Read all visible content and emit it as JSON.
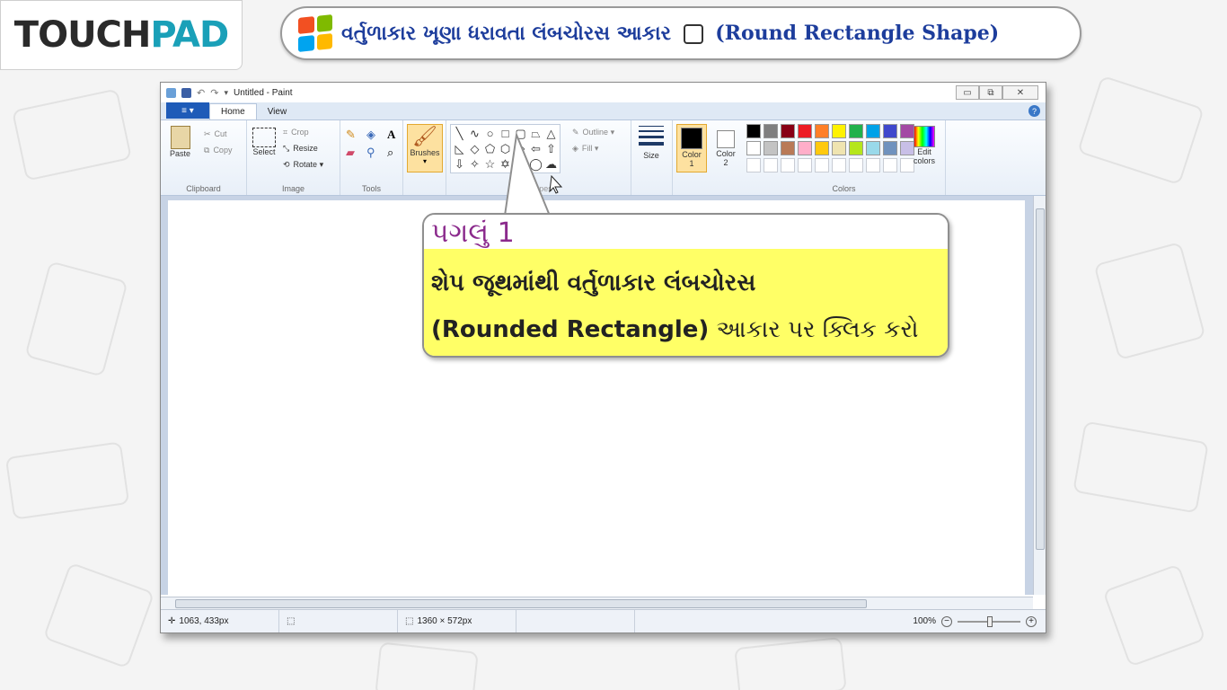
{
  "logo": {
    "part1": "TOUCH",
    "part2": "PAD"
  },
  "title": {
    "gujarati": "વર્તુળાકાર ખૂણા ધરાવતા લંબચોરસ આકાર",
    "english": "(Round Rectangle Shape)"
  },
  "window": {
    "title": "Untitled - Paint",
    "controls": {
      "minimize": "▭",
      "maximize": "⧉",
      "close": "✕"
    }
  },
  "tabs": {
    "file": "≡ ▾",
    "home": "Home",
    "view": "View",
    "help": "?"
  },
  "ribbon": {
    "clipboard": {
      "label": "Clipboard",
      "paste": "Paste",
      "cut": "Cut",
      "copy": "Copy"
    },
    "image": {
      "label": "Image",
      "select": "Select",
      "crop": "Crop",
      "resize": "Resize",
      "rotate": "Rotate ▾"
    },
    "tools": {
      "label": "Tools"
    },
    "brushes": {
      "label": "Brushes"
    },
    "shapes": {
      "label": "Shapes",
      "outline": "Outline ▾",
      "fill": "Fill ▾"
    },
    "size": {
      "label": "Size"
    },
    "color1": {
      "label": "Color",
      "num": "1"
    },
    "color2": {
      "label": "Color",
      "num": "2"
    },
    "colors": {
      "label": "Colors",
      "edit_label": "Edit",
      "edit_label2": "colors",
      "palette": [
        "#000000",
        "#7f7f7f",
        "#880015",
        "#ed1c24",
        "#ff7f27",
        "#fff200",
        "#22b14c",
        "#00a2e8",
        "#3f48cc",
        "#a349a4",
        "#ffffff",
        "#c3c3c3",
        "#b97a57",
        "#ffaec9",
        "#ffc90e",
        "#efe4b0",
        "#b5e61d",
        "#99d9ea",
        "#7092be",
        "#c8bfe7",
        "#ffffff",
        "#ffffff",
        "#ffffff",
        "#ffffff",
        "#ffffff",
        "#ffffff",
        "#ffffff",
        "#ffffff",
        "#ffffff",
        "#ffffff"
      ]
    }
  },
  "status": {
    "cursor": "1063, 433px",
    "canvas_size": "1360 × 572px",
    "zoom": "100%"
  },
  "callout": {
    "step": "પગલું 1",
    "line1": "શેપ જૂથમાંથી વર્તુળાકાર લંબચોરસ",
    "line2_bold": "(Rounded Rectangle)",
    "line2_rest": " આકાર પર ક્લિક કરો"
  },
  "colors": {
    "accent_blue": "#1d3d9c",
    "pad_teal": "#1aa0b8",
    "callout_yellow": "#ffff66",
    "step_purple": "#8b2a8c"
  }
}
